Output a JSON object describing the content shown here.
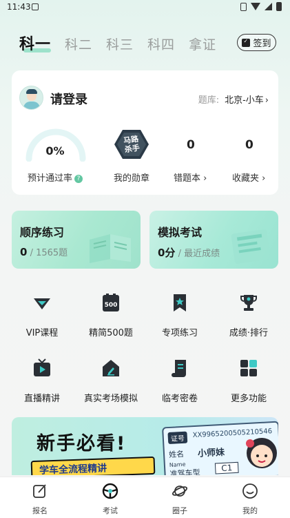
{
  "status_bar": {
    "time": "11:43"
  },
  "subjects": {
    "tabs": [
      "科一",
      "科二",
      "科三",
      "科四",
      "拿证"
    ],
    "active": "科一"
  },
  "checkin": {
    "label": "签到"
  },
  "user_card": {
    "login_text": "请登录",
    "bank_label": "题库:",
    "bank_value": "北京-小车",
    "pass_rate": "0%",
    "pass_rate_label": "预计通过率",
    "medal_text": "马路杀手",
    "medal_label": "我的勋章",
    "wrong_count": "0",
    "wrong_label": "错题本",
    "fav_count": "0",
    "fav_label": "收藏夹"
  },
  "tiles": {
    "sequential": {
      "title": "顺序练习",
      "value": "0",
      "suffix": "/ 1565题"
    },
    "mock": {
      "title": "模拟考试",
      "value": "0分",
      "suffix": "/ 最近成绩"
    }
  },
  "grid_items": [
    {
      "label": "VIP课程",
      "icon": "vip-diamond-icon"
    },
    {
      "label": "精简500题",
      "icon": "500-board-icon",
      "badge": "500"
    },
    {
      "label": "专项练习",
      "icon": "bookmark-star-icon"
    },
    {
      "label": "成绩·排行",
      "icon": "trophy-icon"
    },
    {
      "label": "直播精讲",
      "icon": "tv-play-icon"
    },
    {
      "label": "真实考场模拟",
      "icon": "house-pen-icon"
    },
    {
      "label": "临考密卷",
      "icon": "scroll-icon"
    },
    {
      "label": "更多功能",
      "icon": "grid-icon"
    }
  ],
  "banner": {
    "headline": "新手必看!",
    "strip": "学车全流程精讲",
    "license_tag": "证号",
    "license_no": "XX9965200505210546",
    "name_key": "姓名",
    "name_key_en": "Name",
    "name_value": "小师妹",
    "class_key": "准驾车型",
    "class_value": "C1"
  },
  "tabbar": [
    "报名",
    "考试",
    "圈子",
    "我的"
  ],
  "colors": {
    "accent": "#5ed3ad",
    "help": "#63c7a2",
    "icon_dark": "#2a2f35",
    "icon_teal": "#3ec9c5"
  }
}
